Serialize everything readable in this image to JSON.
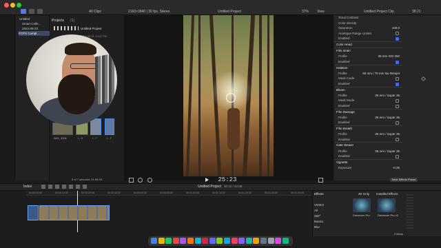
{
  "window": {
    "title": "Untitled Project",
    "clip_filter": "All Clips",
    "format_info": "2160×3840 | 30 fps, Stereo",
    "zoom": "37%",
    "view_menu": "View",
    "inspector_title": "Untitled Project Clip",
    "duration_top": "38:21"
  },
  "sidebar": {
    "items": [
      {
        "label": "Untitled"
      },
      {
        "label": "Smart Colle..."
      },
      {
        "label": "2023-09-23"
      },
      {
        "label": "FCPX Compl..."
      }
    ]
  },
  "browser": {
    "title": "Projects",
    "count": "(1)",
    "project_name": "Untitled Project",
    "project_date": "2023-09-23, 10:47 PM",
    "status": "5 of 7 selected, 01:59:28",
    "thumbs": [
      {
        "label": "IMG_3206"
      },
      {
        "label": "I...0"
      },
      {
        "label": "I...7"
      },
      {
        "label": "I...7"
      }
    ]
  },
  "viewer": {
    "timecode": "25:23"
  },
  "inspector": {
    "rows": [
      {
        "label": "Tonal Contrast",
        "kind": "row"
      },
      {
        "label": "Color density",
        "kind": "row"
      },
      {
        "label": "Saturation",
        "kind": "row",
        "value": "100.0"
      },
      {
        "label": "Analogue Range Limiter",
        "kind": "check",
        "on": false
      },
      {
        "label": "Enabled",
        "kind": "check",
        "on": true
      },
      {
        "label": "Color Head",
        "kind": "section"
      },
      {
        "label": "Film Grain",
        "kind": "section"
      },
      {
        "label": "Profile",
        "kind": "row",
        "value": "35 mm ISO 250"
      },
      {
        "label": "Enabled",
        "kind": "check",
        "on": true
      },
      {
        "label": "Halation",
        "kind": "section"
      },
      {
        "label": "Profile",
        "kind": "row",
        "value": "65 mm / 70 mm No Remjet"
      },
      {
        "label": "Mask mode",
        "kind": "check",
        "on": false
      },
      {
        "label": "Enabled",
        "kind": "check",
        "on": true
      },
      {
        "label": "Bloom",
        "kind": "section"
      },
      {
        "label": "Profile",
        "kind": "row",
        "value": "35 mm / Super 35"
      },
      {
        "label": "Mask Mode",
        "kind": "check",
        "on": false
      },
      {
        "label": "Enabled",
        "kind": "check",
        "on": false
      },
      {
        "label": "Film Damage",
        "kind": "section"
      },
      {
        "label": "Profile",
        "kind": "row",
        "value": "35 mm / Super 35"
      },
      {
        "label": "Enabled",
        "kind": "check",
        "on": false
      },
      {
        "label": "Film Breath",
        "kind": "section"
      },
      {
        "label": "Profile",
        "kind": "row",
        "value": "35 mm / Super 35"
      },
      {
        "label": "Enabled",
        "kind": "check",
        "on": false
      },
      {
        "label": "Gate Weave",
        "kind": "section"
      },
      {
        "label": "Profile",
        "kind": "row",
        "value": "35 mm / Super 35"
      },
      {
        "label": "Enabled",
        "kind": "check",
        "on": false
      },
      {
        "label": "Vignette",
        "kind": "section"
      },
      {
        "label": "Exposure",
        "kind": "row",
        "value": "-0.25"
      }
    ],
    "save_preset": "Save Effects Preset"
  },
  "timeline": {
    "index_label": "Index",
    "project_label": "Untitled Project",
    "duration": "30:31 / 42:09",
    "ruler_marks": [
      "00:00:00:00",
      "00:00:10:00",
      "00:00:20:00",
      "00:00:30:00",
      "00:00:40:00",
      "00:00:50:00",
      "00:01:00:00",
      "00:01:10:00",
      "00:01:20:00",
      "00:01:30:00",
      "00:01:40:00"
    ]
  },
  "effects": {
    "title": "Effects",
    "filter": "4K Only",
    "installed": "Installed Effects",
    "categories": [
      "VIDEO",
      "All",
      "360°",
      "Basics",
      "Blur"
    ],
    "items": [
      {
        "label": "Dehancer Pro"
      },
      {
        "label": "Dehancer Pro v2"
      }
    ],
    "count": "2 items"
  }
}
